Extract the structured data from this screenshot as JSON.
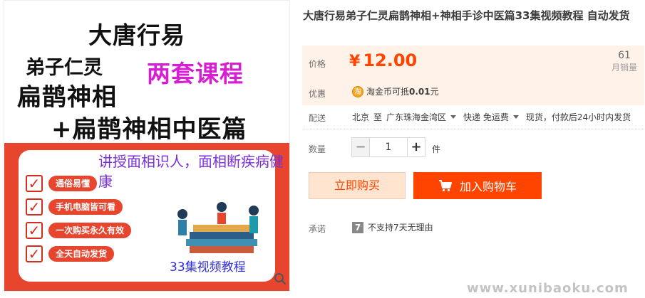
{
  "product_image": {
    "title": "大唐行易",
    "disciple": "弟子仁灵",
    "two_courses": "两套课程",
    "bianque": "扁鹊神相",
    "plus_line": "+扁鹊神相中医篇",
    "teaching": "讲授面相识人，面相断疾病健康",
    "features": [
      "通俗易懂",
      "手机电脑皆可看",
      "一次购买永久有效",
      "全天自动发货"
    ],
    "videos": "33集视频教程",
    "accent_color": "#e8452e"
  },
  "product": {
    "title": "大唐行易弟子仁灵扁鹊神相+神相手诊中医篇33集视频教程 自动发货"
  },
  "price": {
    "label": "价格",
    "currency": "¥",
    "value": "12.00",
    "sales_count": "61",
    "sales_label": "月销量",
    "color": "#ff4400"
  },
  "promo": {
    "label": "优惠",
    "icon": "taojinbi-coin-icon",
    "coin_glyph": "淘",
    "text_prefix": "淘金币可抵",
    "amount": "0.01",
    "text_suffix": "元"
  },
  "shipping": {
    "label": "配送",
    "from": "北京",
    "to_word": "至",
    "destination": "广东珠海金湾区",
    "method": "快递 免运费",
    "stock_note": "现货，付款后24小时内发货"
  },
  "quantity": {
    "label": "数量",
    "minus": "−",
    "value": "1",
    "plus": "+",
    "unit": "件"
  },
  "actions": {
    "buy_now": "立即购买",
    "add_to_cart": "加入购物车"
  },
  "promise": {
    "label": "承诺",
    "badge": "7",
    "text": "不支持7天无理由"
  },
  "watermark": "www.xunibaoku.com"
}
